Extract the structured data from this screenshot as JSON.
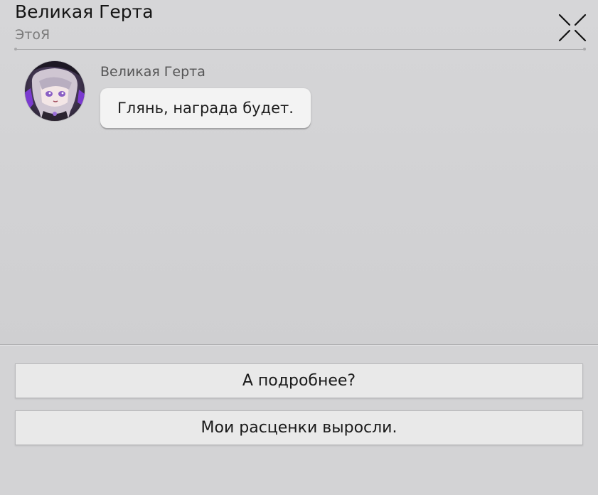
{
  "header": {
    "title": "Великая Герта",
    "subtitle": "ЭтоЯ",
    "close_icon": "close-x-icon"
  },
  "message": {
    "sender": "Великая Герта",
    "text": "Глянь, награда будет.",
    "avatar": "character-avatar"
  },
  "options": [
    {
      "label": "А подробнее?"
    },
    {
      "label": "Мои расценки выросли."
    }
  ],
  "colors": {
    "background": "#d3d3d5",
    "bubble": "#f3f3f3",
    "option": "#e9e9e9",
    "muted_text": "#7b7b7b"
  }
}
